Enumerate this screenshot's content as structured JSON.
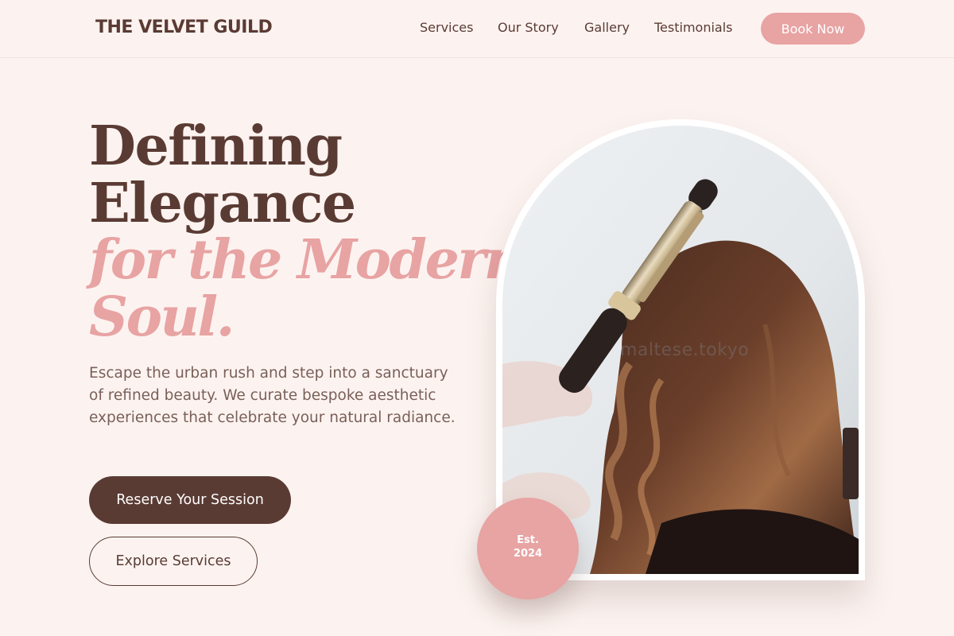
{
  "header": {
    "brand": "THE VELVET GUILD",
    "nav": [
      "Services",
      "Our Story",
      "Gallery",
      "Testimonials"
    ],
    "cta": "Book Now"
  },
  "hero": {
    "title_line1": "Defining",
    "title_line2": "Elegance",
    "title_accent_line1": "for the Modern",
    "title_accent_line2": "Soul.",
    "lead": "Escape the urban rush and step into a sanctuary of refined beauty. We curate bespoke aesthetic experiences that celebrate your natural radiance.",
    "primary_button": "Reserve Your Session",
    "secondary_button": "Explore Services"
  },
  "image": {
    "watermark": "maltese.tokyo",
    "badge_label": "Est.",
    "badge_year": "2024"
  },
  "colors": {
    "background": "#fcf3f0",
    "brand_dark": "#5a3b33",
    "accent_pink": "#e8a3a3",
    "body_text": "#7a5f58"
  },
  "icons": [
    "curling-iron-photo"
  ]
}
